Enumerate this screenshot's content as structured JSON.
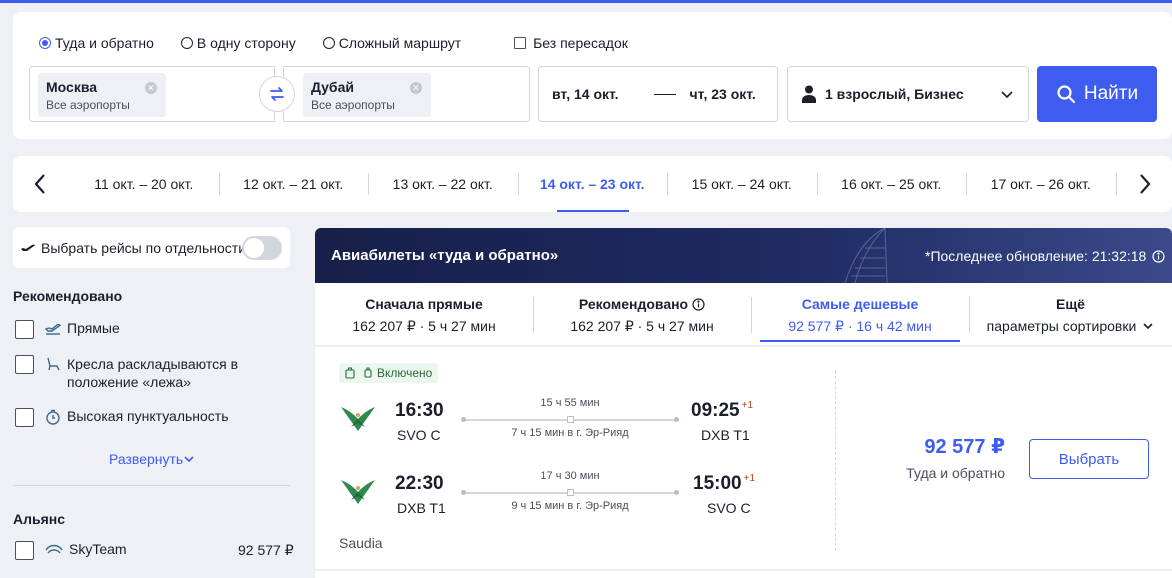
{
  "search": {
    "trip_options": [
      "Туда и обратно",
      "В одну сторону",
      "Сложный маршрут"
    ],
    "selected_trip": 0,
    "nonstop_label": "Без пересадок",
    "from": {
      "city": "Москва",
      "sub": "Все аэропорты"
    },
    "to": {
      "city": "Дубай",
      "sub": "Все аэропорты"
    },
    "date_out": "вт, 14 окт.",
    "date_back": "чт, 23 окт.",
    "passengers": "1 взрослый, Бизнес",
    "find_label": "Найти"
  },
  "carousel": {
    "items": [
      "11 окт. – 20 окт.",
      "12 окт. – 21 окт.",
      "13 окт. – 22 окт.",
      "14 окт. – 23 окт.",
      "15 окт. – 24 окт.",
      "16 окт. – 25 окт.",
      "17 окт. – 26 окт."
    ],
    "active_index": 3
  },
  "filters": {
    "separate_label": "Выбрать рейсы по отдельности",
    "recommended_title": "Рекомендовано",
    "recommended": [
      {
        "label": "Прямые",
        "icon": "direct-flight-icon"
      },
      {
        "label": "Кресла раскладываются в положение «лежа»",
        "icon": "seat-icon"
      },
      {
        "label": "Высокая пунктуальность",
        "icon": "clock-icon"
      }
    ],
    "expand_label": "Развернуть",
    "alliance_title": "Альянс",
    "alliance": [
      {
        "label": "SkyTeam",
        "price": "92 577 ₽",
        "icon": "skyteam-icon"
      }
    ]
  },
  "results": {
    "title": "Авиабилеты «туда и обратно»",
    "updated": "*Последнее обновление: 21:32:18",
    "sort": [
      {
        "title": "Сначала прямые",
        "sub": "162 207 ₽ · 5 ч 27 мин"
      },
      {
        "title": "Рекомендовано",
        "sub": "162 207 ₽ · 5 ч 27 мин"
      },
      {
        "title": "Самые дешевые",
        "sub": "92 577 ₽ · 16 ч 42 мин"
      },
      {
        "title": "Ещё",
        "sub": "параметры сортировки"
      }
    ],
    "active_sort": 2
  },
  "ticket": {
    "badge": "Включено",
    "segments": [
      {
        "dep_time": "16:30",
        "dep_ap": "SVO C",
        "arr_time": "09:25",
        "plus": "+1",
        "arr_ap": "DXB T1",
        "duration": "15 ч 55 мин",
        "stop": "7 ч 15 мин в г. Эр-Рияд"
      },
      {
        "dep_time": "22:30",
        "dep_ap": "DXB T1",
        "arr_time": "15:00",
        "plus": "+1",
        "arr_ap": "SVO C",
        "duration": "17 ч 30 мин",
        "stop": "9 ч 15 мин в г. Эр-Рияд"
      }
    ],
    "airline": "Saudia",
    "price": "92 577 ₽",
    "price_sub": "Туда и обратно",
    "select_label": "Выбрать"
  },
  "colors": {
    "accent": "#3f5cf0",
    "header_bg": "#17204a"
  }
}
